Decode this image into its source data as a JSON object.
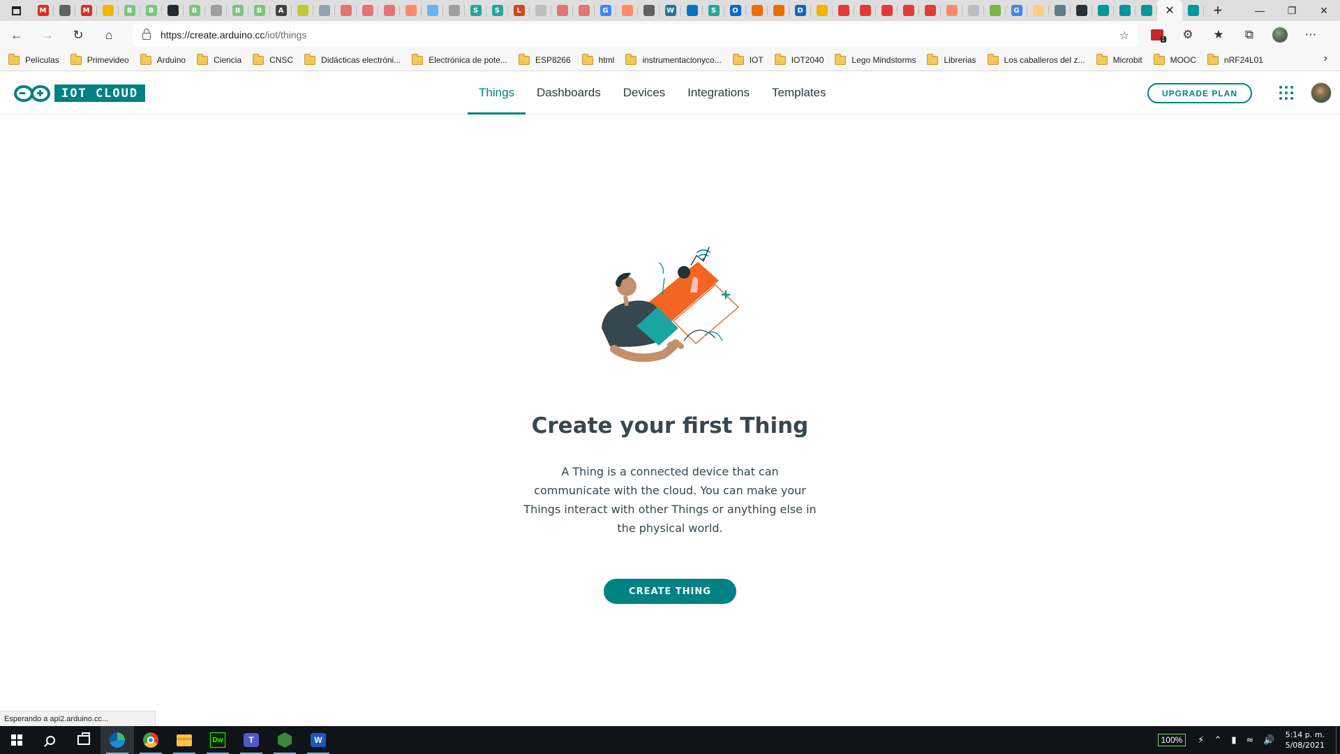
{
  "browser": {
    "tabs": [
      {
        "icon": "window-menu-icon"
      },
      {
        "icon": "gmail-icon",
        "color": "#d93025",
        "glyph": "M"
      },
      {
        "icon": "page-icon",
        "color": "#5f6368",
        "glyph": ""
      },
      {
        "icon": "gmail-icon",
        "color": "#d93025",
        "glyph": "M"
      },
      {
        "icon": "drive-icon",
        "color": "#f4b400",
        "glyph": ""
      },
      {
        "icon": "blogger-b-icon",
        "color": "#7cc47f",
        "glyph": "B"
      },
      {
        "icon": "blogger-b-icon",
        "color": "#7cc47f",
        "glyph": "B"
      },
      {
        "icon": "github-icon",
        "color": "#24292e",
        "glyph": ""
      },
      {
        "icon": "blogger-b-icon",
        "color": "#7cc47f",
        "glyph": "B"
      },
      {
        "icon": "page-icon",
        "color": "#9e9e9e",
        "glyph": ""
      },
      {
        "icon": "blogger-b-icon",
        "color": "#7cc47f",
        "glyph": "B"
      },
      {
        "icon": "blogger-b-icon",
        "color": "#7cc47f",
        "glyph": "B"
      },
      {
        "icon": "text-a-icon",
        "color": "#424242",
        "glyph": "A"
      },
      {
        "icon": "image-icon",
        "color": "#c0ca33",
        "glyph": ""
      },
      {
        "icon": "video-icon",
        "color": "#90a4ae",
        "glyph": ""
      },
      {
        "icon": "youtube-icon",
        "color": "#e57373",
        "glyph": ""
      },
      {
        "icon": "youtube-icon",
        "color": "#e57373",
        "glyph": ""
      },
      {
        "icon": "play-icon",
        "color": "#e57373",
        "glyph": ""
      },
      {
        "icon": "blogger-icon",
        "color": "#ff8a65",
        "glyph": ""
      },
      {
        "icon": "snowflake-icon",
        "color": "#64b5f6",
        "glyph": ""
      },
      {
        "icon": "page-icon",
        "color": "#9e9e9e",
        "glyph": ""
      },
      {
        "icon": "scribd-s-icon",
        "color": "#26a69a",
        "glyph": "S"
      },
      {
        "icon": "scribd-s-icon",
        "color": "#26a69a",
        "glyph": "S"
      },
      {
        "icon": "letter-l-icon",
        "color": "#d84315",
        "glyph": "L"
      },
      {
        "icon": "page-icon",
        "color": "#bdbdbd",
        "glyph": ""
      },
      {
        "icon": "youtube-icon",
        "color": "#e57373",
        "glyph": ""
      },
      {
        "icon": "youtube-icon",
        "color": "#e57373",
        "glyph": ""
      },
      {
        "icon": "google-icon",
        "color": "#4285f4",
        "glyph": "G"
      },
      {
        "icon": "blogger-icon",
        "color": "#ff8a65",
        "glyph": ""
      },
      {
        "icon": "circle-icon",
        "color": "#616161",
        "glyph": ""
      },
      {
        "icon": "wordpress-icon",
        "color": "#21759b",
        "glyph": "W"
      },
      {
        "icon": "circle-icon",
        "color": "#0277bd",
        "glyph": ""
      },
      {
        "icon": "scribd-s-icon",
        "color": "#26a69a",
        "glyph": "S"
      },
      {
        "icon": "outlook-icon",
        "color": "#0a64d8",
        "glyph": "O"
      },
      {
        "icon": "shield-orange-icon",
        "color": "#ef6c00",
        "glyph": ""
      },
      {
        "icon": "shield-orange-icon",
        "color": "#ef6c00",
        "glyph": ""
      },
      {
        "icon": "ieee-icon",
        "color": "#1565c0",
        "glyph": "D"
      },
      {
        "icon": "drive-icon",
        "color": "#f4b400",
        "glyph": ""
      },
      {
        "icon": "youtube-icon",
        "color": "#e53935",
        "glyph": ""
      },
      {
        "icon": "youtube-icon",
        "color": "#e53935",
        "glyph": ""
      },
      {
        "icon": "youtube-icon",
        "color": "#e53935",
        "glyph": ""
      },
      {
        "icon": "youtube-icon",
        "color": "#e53935",
        "glyph": ""
      },
      {
        "icon": "youtube-icon",
        "color": "#e53935",
        "glyph": ""
      },
      {
        "icon": "blogger-icon",
        "color": "#ff8a65",
        "glyph": ""
      },
      {
        "icon": "page-icon",
        "color": "#bdbdbd",
        "glyph": ""
      },
      {
        "icon": "board-icon",
        "color": "#7cb342",
        "glyph": ""
      },
      {
        "icon": "google-icon",
        "color": "#4285f4",
        "glyph": "G"
      },
      {
        "icon": "page-icon",
        "color": "#ffcc80",
        "glyph": ""
      },
      {
        "icon": "arduino-icon",
        "color": "#607d8b",
        "glyph": ""
      },
      {
        "icon": "arduino-icon",
        "color": "#263238",
        "glyph": ""
      },
      {
        "icon": "arduino-icon",
        "color": "#00979d",
        "glyph": ""
      },
      {
        "icon": "arduino-icon",
        "color": "#00979d",
        "glyph": ""
      },
      {
        "icon": "arduino-icon",
        "color": "#00979d",
        "glyph": ""
      },
      {
        "icon": "close-icon",
        "active": true
      },
      {
        "icon": "arduino-icon",
        "color": "#00979d",
        "glyph": ""
      }
    ],
    "address": {
      "host": "https://create.arduino.cc",
      "path": "/iot/things"
    },
    "bookmarks": [
      "Películas",
      "Primevideo",
      "Arduino",
      "Ciencia",
      "CNSC",
      "Didácticas electróni...",
      "Electrónica de pote...",
      "ESP8266",
      "html",
      "instrumentacionyco...",
      "IOT",
      "IOT2040",
      "Lego Mindstorms",
      "Librerias",
      "Los caballeros del z...",
      "Microbit",
      "MOOC",
      "nRF24L01"
    ],
    "ext_badge": "1",
    "status_text": "Esperando a api2.arduino.cc..."
  },
  "app": {
    "logo_text": "IOT CLOUD",
    "nav": [
      "Things",
      "Dashboards",
      "Devices",
      "Integrations",
      "Templates"
    ],
    "active_nav": "Things",
    "upgrade_label": "UPGRADE PLAN",
    "accent_color": "#008184"
  },
  "empty_state": {
    "title": "Create your first Thing",
    "description": "A Thing is a connected device that can communicate with the cloud. You can make your Things interact with other Things or anything else in the physical world.",
    "cta_label": "CREATE THING"
  },
  "taskbar": {
    "apps": [
      "windows-start",
      "search",
      "task-view",
      "edge",
      "chrome",
      "file-explorer",
      "dreamweaver",
      "teams",
      "node",
      "word"
    ],
    "dw_label": "Dw",
    "zoom": "100%",
    "time": "5:14 p. m.",
    "date": "5/08/2021"
  }
}
